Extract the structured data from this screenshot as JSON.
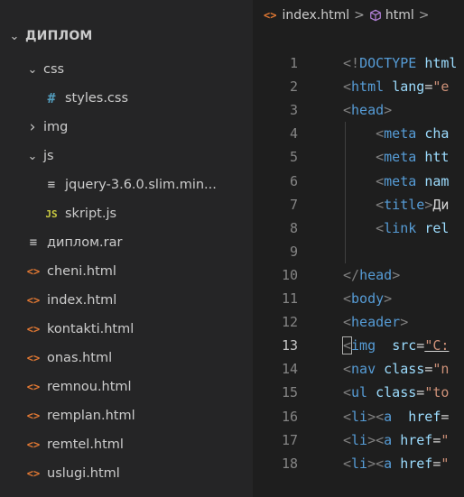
{
  "explorer": {
    "root": {
      "label": "ДИПЛОМ",
      "icon": "chevron-down-icon"
    },
    "items": [
      {
        "type": "folder",
        "label": "css",
        "expanded": true,
        "icon": "chevron-down-icon"
      },
      {
        "type": "file",
        "label": "styles.css",
        "icon": "css-file-icon",
        "glyph": "#"
      },
      {
        "type": "folder",
        "label": "img",
        "expanded": false,
        "icon": "chevron-right-icon"
      },
      {
        "type": "folder",
        "label": "js",
        "expanded": true,
        "icon": "chevron-down-icon"
      },
      {
        "type": "file",
        "label": "jquery-3.6.0.slim.min...",
        "icon": "text-file-icon",
        "glyph": "≡"
      },
      {
        "type": "file",
        "label": "skript.js",
        "icon": "js-file-icon",
        "glyph": "JS"
      },
      {
        "type": "file",
        "label": "диплом.rar",
        "icon": "text-file-icon",
        "glyph": "≡"
      },
      {
        "type": "file",
        "label": "cheni.html",
        "icon": "html-file-icon",
        "glyph": "<>"
      },
      {
        "type": "file",
        "label": "index.html",
        "icon": "html-file-icon",
        "glyph": "<>"
      },
      {
        "type": "file",
        "label": "kontakti.html",
        "icon": "html-file-icon",
        "glyph": "<>"
      },
      {
        "type": "file",
        "label": "onas.html",
        "icon": "html-file-icon",
        "glyph": "<>"
      },
      {
        "type": "file",
        "label": "remnou.html",
        "icon": "html-file-icon",
        "glyph": "<>"
      },
      {
        "type": "file",
        "label": "remplan.html",
        "icon": "html-file-icon",
        "glyph": "<>"
      },
      {
        "type": "file",
        "label": "remtel.html",
        "icon": "html-file-icon",
        "glyph": "<>"
      },
      {
        "type": "file",
        "label": "uslugi.html",
        "icon": "html-file-icon",
        "glyph": "<>"
      }
    ]
  },
  "breadcrumb": {
    "file_glyph": "<>",
    "file": "index.html",
    "separator": ">",
    "element": "html",
    "trailing_separator": ">"
  },
  "editor": {
    "active_line": 13,
    "lines": [
      {
        "num": "1",
        "tokens": [
          [
            "br",
            "<!"
          ],
          [
            "tag",
            "DOCTYPE"
          ],
          [
            "text",
            " "
          ],
          [
            "attr",
            "html"
          ]
        ]
      },
      {
        "num": "2",
        "tokens": [
          [
            "br",
            "<"
          ],
          [
            "tag",
            "html"
          ],
          [
            "text",
            " "
          ],
          [
            "attr",
            "lang"
          ],
          [
            "text",
            "="
          ],
          [
            "str",
            "\"e"
          ]
        ]
      },
      {
        "num": "3",
        "tokens": [
          [
            "br",
            "<"
          ],
          [
            "tag",
            "head"
          ],
          [
            "br",
            ">"
          ]
        ]
      },
      {
        "num": "4",
        "tokens": [
          [
            "text",
            "    "
          ],
          [
            "br",
            "<"
          ],
          [
            "tag",
            "meta"
          ],
          [
            "text",
            " "
          ],
          [
            "attr",
            "cha"
          ]
        ]
      },
      {
        "num": "5",
        "tokens": [
          [
            "text",
            "    "
          ],
          [
            "br",
            "<"
          ],
          [
            "tag",
            "meta"
          ],
          [
            "text",
            " "
          ],
          [
            "attr",
            "htt"
          ]
        ]
      },
      {
        "num": "6",
        "tokens": [
          [
            "text",
            "    "
          ],
          [
            "br",
            "<"
          ],
          [
            "tag",
            "meta"
          ],
          [
            "text",
            " "
          ],
          [
            "attr",
            "nam"
          ]
        ]
      },
      {
        "num": "7",
        "tokens": [
          [
            "text",
            "    "
          ],
          [
            "br",
            "<"
          ],
          [
            "tag",
            "title"
          ],
          [
            "br",
            ">"
          ],
          [
            "text",
            "Ди"
          ]
        ]
      },
      {
        "num": "8",
        "tokens": [
          [
            "text",
            "    "
          ],
          [
            "br",
            "<"
          ],
          [
            "tag",
            "link"
          ],
          [
            "text",
            " "
          ],
          [
            "attr",
            "rel"
          ]
        ]
      },
      {
        "num": "9",
        "tokens": []
      },
      {
        "num": "10",
        "tokens": [
          [
            "br",
            "</"
          ],
          [
            "tag",
            "head"
          ],
          [
            "br",
            ">"
          ]
        ]
      },
      {
        "num": "11",
        "tokens": [
          [
            "br",
            "<"
          ],
          [
            "tag",
            "body"
          ],
          [
            "br",
            ">"
          ]
        ]
      },
      {
        "num": "12",
        "tokens": [
          [
            "br",
            "<"
          ],
          [
            "tag",
            "header"
          ],
          [
            "br",
            ">"
          ]
        ]
      },
      {
        "num": "13",
        "tokens": [
          [
            "brc",
            "<"
          ],
          [
            "tag",
            "img"
          ],
          [
            "text",
            "  "
          ],
          [
            "attr",
            "src"
          ],
          [
            "text",
            "="
          ],
          [
            "stru",
            "\"C:"
          ]
        ]
      },
      {
        "num": "14",
        "tokens": [
          [
            "br",
            "<"
          ],
          [
            "tag",
            "nav"
          ],
          [
            "text",
            " "
          ],
          [
            "attr",
            "class"
          ],
          [
            "text",
            "="
          ],
          [
            "str",
            "\"n"
          ]
        ]
      },
      {
        "num": "15",
        "tokens": [
          [
            "br",
            "<"
          ],
          [
            "tag",
            "ul"
          ],
          [
            "text",
            " "
          ],
          [
            "attr",
            "class"
          ],
          [
            "text",
            "="
          ],
          [
            "str",
            "\"to"
          ]
        ]
      },
      {
        "num": "16",
        "tokens": [
          [
            "br",
            "<"
          ],
          [
            "tag",
            "li"
          ],
          [
            "br",
            "><"
          ],
          [
            "tag",
            "a"
          ],
          [
            "text",
            "  "
          ],
          [
            "attr",
            "href"
          ],
          [
            "text",
            "="
          ]
        ]
      },
      {
        "num": "17",
        "tokens": [
          [
            "br",
            "<"
          ],
          [
            "tag",
            "li"
          ],
          [
            "br",
            "><"
          ],
          [
            "tag",
            "a"
          ],
          [
            "text",
            " "
          ],
          [
            "attr",
            "href"
          ],
          [
            "text",
            "="
          ],
          [
            "str",
            "\""
          ]
        ]
      },
      {
        "num": "18",
        "tokens": [
          [
            "br",
            "<"
          ],
          [
            "tag",
            "li"
          ],
          [
            "br",
            "><"
          ],
          [
            "tag",
            "a"
          ],
          [
            "text",
            " "
          ],
          [
            "attr",
            "href"
          ],
          [
            "text",
            "="
          ],
          [
            "str",
            "\""
          ]
        ]
      }
    ]
  },
  "colors": {
    "sidebar_bg": "#252526",
    "editor_bg": "#1e1e1e",
    "tag": "#569cd6",
    "attr": "#9cdcfe",
    "string": "#ce9178",
    "html_icon": "#e37933",
    "css_icon": "#519aba",
    "js_icon": "#cbcb41"
  }
}
